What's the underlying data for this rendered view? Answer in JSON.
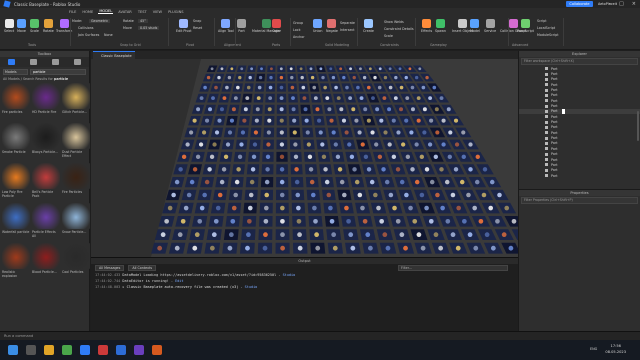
{
  "window": {
    "title": "Classic Baseplate - Roblox Studio",
    "menu": [
      "FILE",
      "HOME",
      "MODEL",
      "AVATAR",
      "TEST",
      "VIEW",
      "PLUGINS"
    ],
    "active_menu": "MODEL",
    "collaborate": "Collaborate",
    "user": "AetoPlaceit"
  },
  "ribbon": {
    "tools": [
      "Select",
      "Move",
      "Scale",
      "Rotate",
      "Transform"
    ],
    "mode_label": "Mode:",
    "mode_value": "Geometric",
    "collisions": "Collisions",
    "join_surfaces": "Join Surfaces",
    "rotate_label": "Rotate",
    "rotate_value": "45°",
    "move_label": "Move",
    "move_value": "0.05 studs",
    "snap_none": "None",
    "pivot_buttons": [
      "Edit Pivot",
      "Reset"
    ],
    "pivot_opts": [
      "Snap",
      "Pivot"
    ],
    "align": "Align Tool",
    "part": "Part",
    "material": "Material Manager",
    "color": "Color",
    "group": "Group",
    "lock": "Lock",
    "anchor": "Anchor",
    "union": "Union",
    "negate": "Negate",
    "separate": "Separate",
    "intersect": "Intersect",
    "create": "Create",
    "constraint_details": "Constraint Details",
    "show_welds": "Show Welds",
    "scale": "Scale",
    "effects": "Effects",
    "spawn": "Spawn",
    "insert_object": "Insert Object",
    "model": "Model",
    "service": "Service",
    "collision_groups": "Collision Groups",
    "run_script": "Run Script",
    "script": "Script",
    "local_script": "LocalScript",
    "module_script": "ModuleScript",
    "groups": [
      "Tools",
      "Snap to Grid",
      "Pivot",
      "Alignment",
      "Parts",
      "Solid Modeling",
      "Constraints",
      "Gameplay",
      "Advanced"
    ]
  },
  "toolbox": {
    "header": "Toolbox",
    "category": "Models",
    "search": "particle",
    "breadcrumb": "All Models / Search Results for",
    "breadcrumb_term": "particle",
    "items": [
      {
        "label": "Fire particles",
        "color": "#b34b1d"
      },
      {
        "label": "HD Particle Fire",
        "color": "#6a2a8c"
      },
      {
        "label": "Glitch Particle...",
        "color": "#d7b05a"
      },
      {
        "label": "Smoke Particle",
        "color": "#7a7a7a"
      },
      {
        "label": "Bloxys Particle...",
        "color": "#1c1c1c"
      },
      {
        "label": "Dust Particle Effect",
        "color": "#d8c49b"
      },
      {
        "label": "Low Poly Fire Particle",
        "color": "#e67a1f"
      },
      {
        "label": "Bell's Particle Pack",
        "color": "#c23c3c"
      },
      {
        "label": "Fire Particles",
        "color": "#3a2214"
      },
      {
        "label": "Waterfall particle",
        "color": "#3e6ec4"
      },
      {
        "label": "Particle Effects All",
        "color": "#6a3fa8"
      },
      {
        "label": "Snow Particle...",
        "color": "#8eb4d8"
      },
      {
        "label": "Realistic explosion",
        "color": "#a03a1b"
      },
      {
        "label": "Blood Particle...",
        "color": "#8f1d1d"
      },
      {
        "label": "Cool Particles",
        "color": "#2a2a2a"
      }
    ]
  },
  "viewport": {
    "tab": "Classic Baseplate"
  },
  "output": {
    "header": "Output",
    "filter_messages": "All Messages",
    "filter_contexts": "All Contexts",
    "filter_placeholder": "Filter...",
    "lines": [
      {
        "time": "17:44:02.433",
        "text": "DataModel Loading https://assetdelivery.roblox.com/v1/asset/?id=95836250l",
        "src": "Studio"
      },
      {
        "time": "17:44:02.744",
        "text": "DataEditor is running!",
        "src": "Edit"
      },
      {
        "time": "17:44:48.003",
        "text": "▸ Classic Baseplate auto-recovery file was created (x3)",
        "src": "Studio"
      }
    ]
  },
  "explorer": {
    "header": "Explorer",
    "filter": "Filter workspace (Ctrl+Shift+X)",
    "items": [
      "Part",
      "Part",
      "Part",
      "Part",
      "Part",
      "Part",
      "Part",
      "Part",
      "Part",
      "Part",
      "Part",
      "Part",
      "Part",
      "Part",
      "Part",
      "Part",
      "Part",
      "Part",
      "Part",
      "Part",
      "Part"
    ],
    "highlight_index": 8
  },
  "properties": {
    "header": "Properties",
    "filter": "Filter Properties (Ctrl+Shift+P)"
  },
  "command": {
    "placeholder": "Run a command"
  },
  "taskbar": {
    "lang": "ENG",
    "time": "17:56",
    "date": "08.05.2023"
  },
  "colors": {
    "accent": "#2f7cf6",
    "tile_bg": "#1b2548",
    "tile_dark": "#0f1530"
  }
}
